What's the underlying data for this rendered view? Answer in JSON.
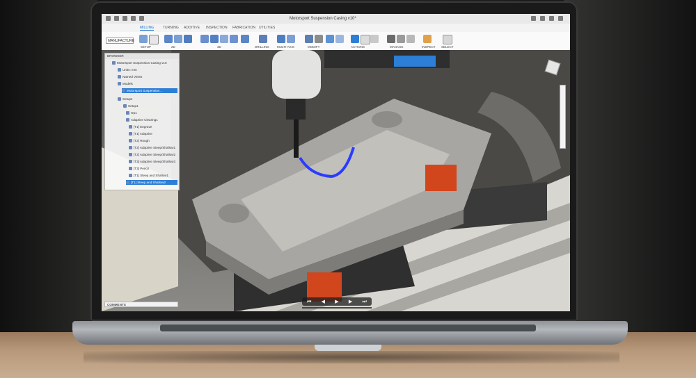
{
  "app": {
    "doc_title": "Motorsport Suspension Casing v10*"
  },
  "tabs": [
    "MILLING",
    "TURNING",
    "ADDITIVE",
    "INSPECTION",
    "FABRICATION",
    "UTILITIES"
  ],
  "workspace": "MANUFACTURE",
  "ribbon_groups": [
    "SETUP",
    "2D",
    "3D",
    "DRILLING",
    "MULTI-AXIS",
    "MODIFY",
    "ACTIONS",
    "MANAGE",
    "INSPECT",
    "SELECT"
  ],
  "browser": {
    "title": "BROWSER",
    "items": [
      {
        "label": "Motorsport Suspension Casing v10",
        "selected": false
      },
      {
        "label": "Units: mm",
        "selected": false
      },
      {
        "label": "Named Views",
        "selected": false
      },
      {
        "label": "Models",
        "selected": false
      },
      {
        "label": "Motorsport Suspension...",
        "selected": true
      },
      {
        "label": "Setups",
        "selected": false
      },
      {
        "label": "Setup1",
        "selected": false
      },
      {
        "label": "Op1",
        "selected": false
      },
      {
        "label": "Adaptive Clearing1",
        "selected": false
      },
      {
        "label": "[T1] Engrave",
        "selected": false
      },
      {
        "label": "[T1] Adaptive",
        "selected": false
      },
      {
        "label": "[T2] Rough",
        "selected": false
      },
      {
        "label": "[T2] Adaptive Steep/Shallow1",
        "selected": false
      },
      {
        "label": "[T2] Adaptive Steep/Shallow2",
        "selected": false
      },
      {
        "label": "[T3] Adaptive Steep/Shallow3",
        "selected": false
      },
      {
        "label": "[T3] Pencil",
        "selected": false
      },
      {
        "label": "[T1] Steep and Shallow1",
        "selected": false
      },
      {
        "label": "[T1] Steep and Shallow2",
        "selected": true
      }
    ]
  },
  "comments_label": "COMMENTS",
  "colors": {
    "accent": "#2c7ed6",
    "toolpath": "#2a3cff",
    "fixture_orange": "#d2461e"
  }
}
